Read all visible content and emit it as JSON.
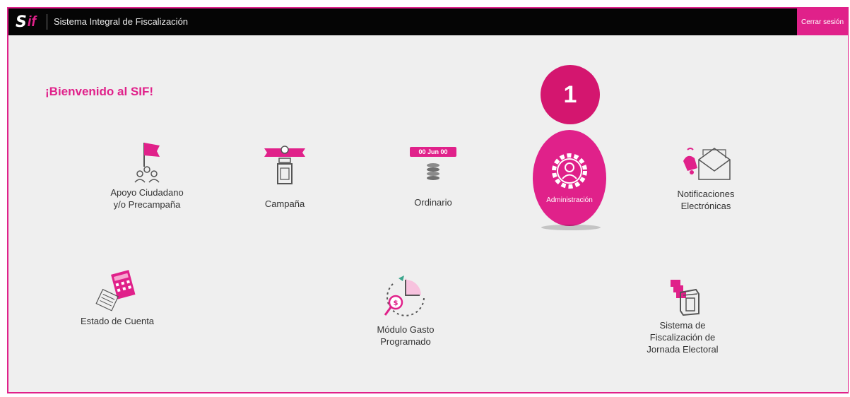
{
  "header": {
    "logo_s": "S",
    "logo_if": "if",
    "title": "Sistema Integral de Fiscalización",
    "logout_label": "Cerrar sesión"
  },
  "welcome": "¡Bienvenido al SIF!",
  "step_badge": "1",
  "modules": {
    "apoyo": "Apoyo Ciudadano\ny/o Precampaña",
    "campana": "Campaña",
    "ordinario": "Ordinario",
    "ordinario_calendar": "00 Jun 00",
    "administracion": "Administración",
    "notificaciones": "Notificaciones\nElectrónicas",
    "estado_cuenta": "Estado de Cuenta",
    "gasto_programado": "Módulo Gasto\nProgramado",
    "jornada_electoral": "Sistema de\nFiscalización de\nJornada Electoral"
  },
  "colors": {
    "accent": "#e0218a",
    "badge": "#d4166f",
    "topbar": "#050505",
    "background": "#efefef"
  }
}
